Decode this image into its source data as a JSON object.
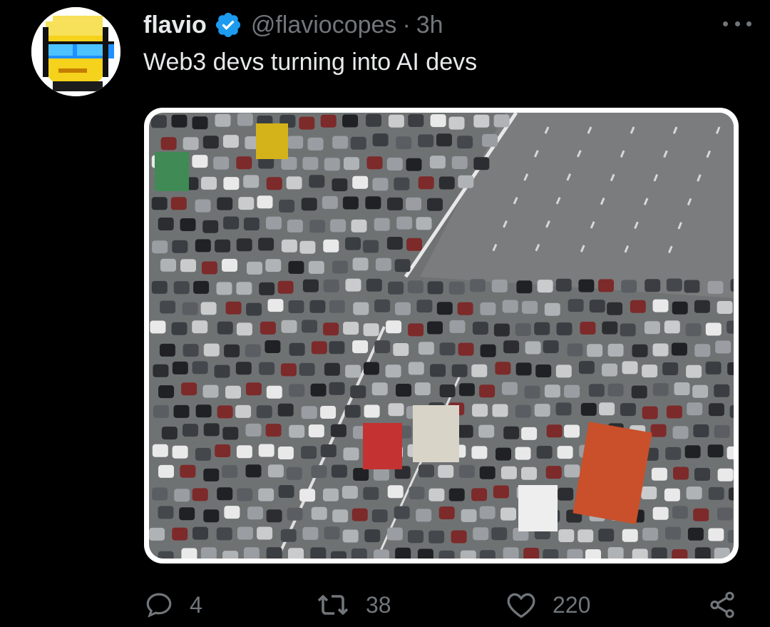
{
  "tweet": {
    "author_name": "flavio",
    "handle": "@flaviocopes",
    "separator": "·",
    "time": "3h",
    "text": "Web3 devs turning into AI devs"
  },
  "actions": {
    "replies": "4",
    "reposts": "38",
    "likes": "220"
  },
  "icons": {
    "avatar": "pixel-avatar-sunglasses",
    "verified": "verified-badge-icon",
    "more": "more-icon",
    "reply": "reply-icon",
    "repost": "repost-icon",
    "like": "heart-icon",
    "share": "share-icon"
  },
  "colors": {
    "background": "#000000",
    "text_primary": "#e7e9ea",
    "text_secondary": "#71767b",
    "verified_blue": "#1d9bf0"
  }
}
